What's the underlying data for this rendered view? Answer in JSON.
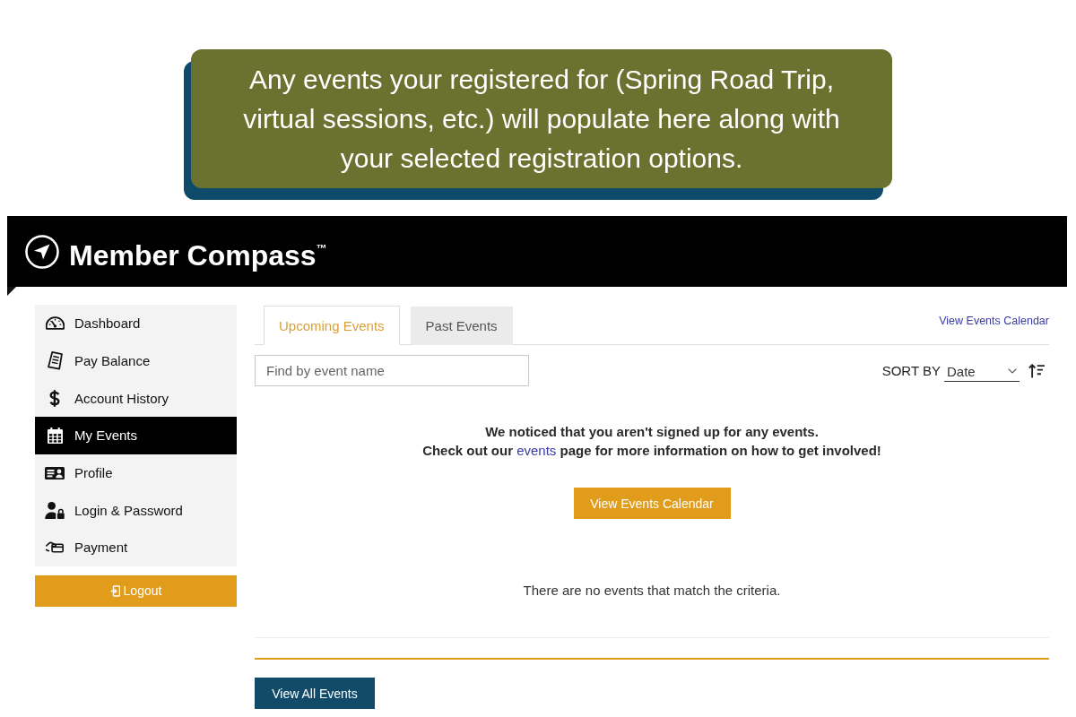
{
  "callout": {
    "text": "Any events your registered for (Spring Road Trip, virtual sessions, etc.) will populate here along with your selected registration options."
  },
  "header": {
    "brand": "Member Compass$^{™}$"
  },
  "sidebar": {
    "items": [
      {
        "label": "Dashboard",
        "selected": false
      },
      {
        "label": "Pay Balance",
        "selected": false
      },
      {
        "label": "Account History",
        "selected": false
      },
      {
        "label": "My Events",
        "selected": true
      },
      {
        "label": "Profile",
        "selected": false
      },
      {
        "label": "Login & Password",
        "selected": false
      },
      {
        "label": "Payment",
        "selected": false
      }
    ],
    "logout_button": "Logout"
  },
  "main": {
    "tabs": [
      {
        "label": "Upcoming Events",
        "selected": true
      },
      {
        "label": "Past Events",
        "selected": false
      }
    ],
    "calendar_link": "View Events Calendar",
    "search": {
      "placeholder": "Find by event name"
    },
    "sort": {
      "label": "SORT BY",
      "value": "Date"
    },
    "notice": {
      "line_1": "We noticed that you aren't signed up for any events.",
      "line_2_start": "Check out our",
      "link": "events",
      "line_2_end": "page for more information on how to get involved!"
    },
    "calendar_button": "View Events Calendar",
    "empty_message": "There are no events that match the criteria.",
    "view_all_button": "View All Events"
  }
}
